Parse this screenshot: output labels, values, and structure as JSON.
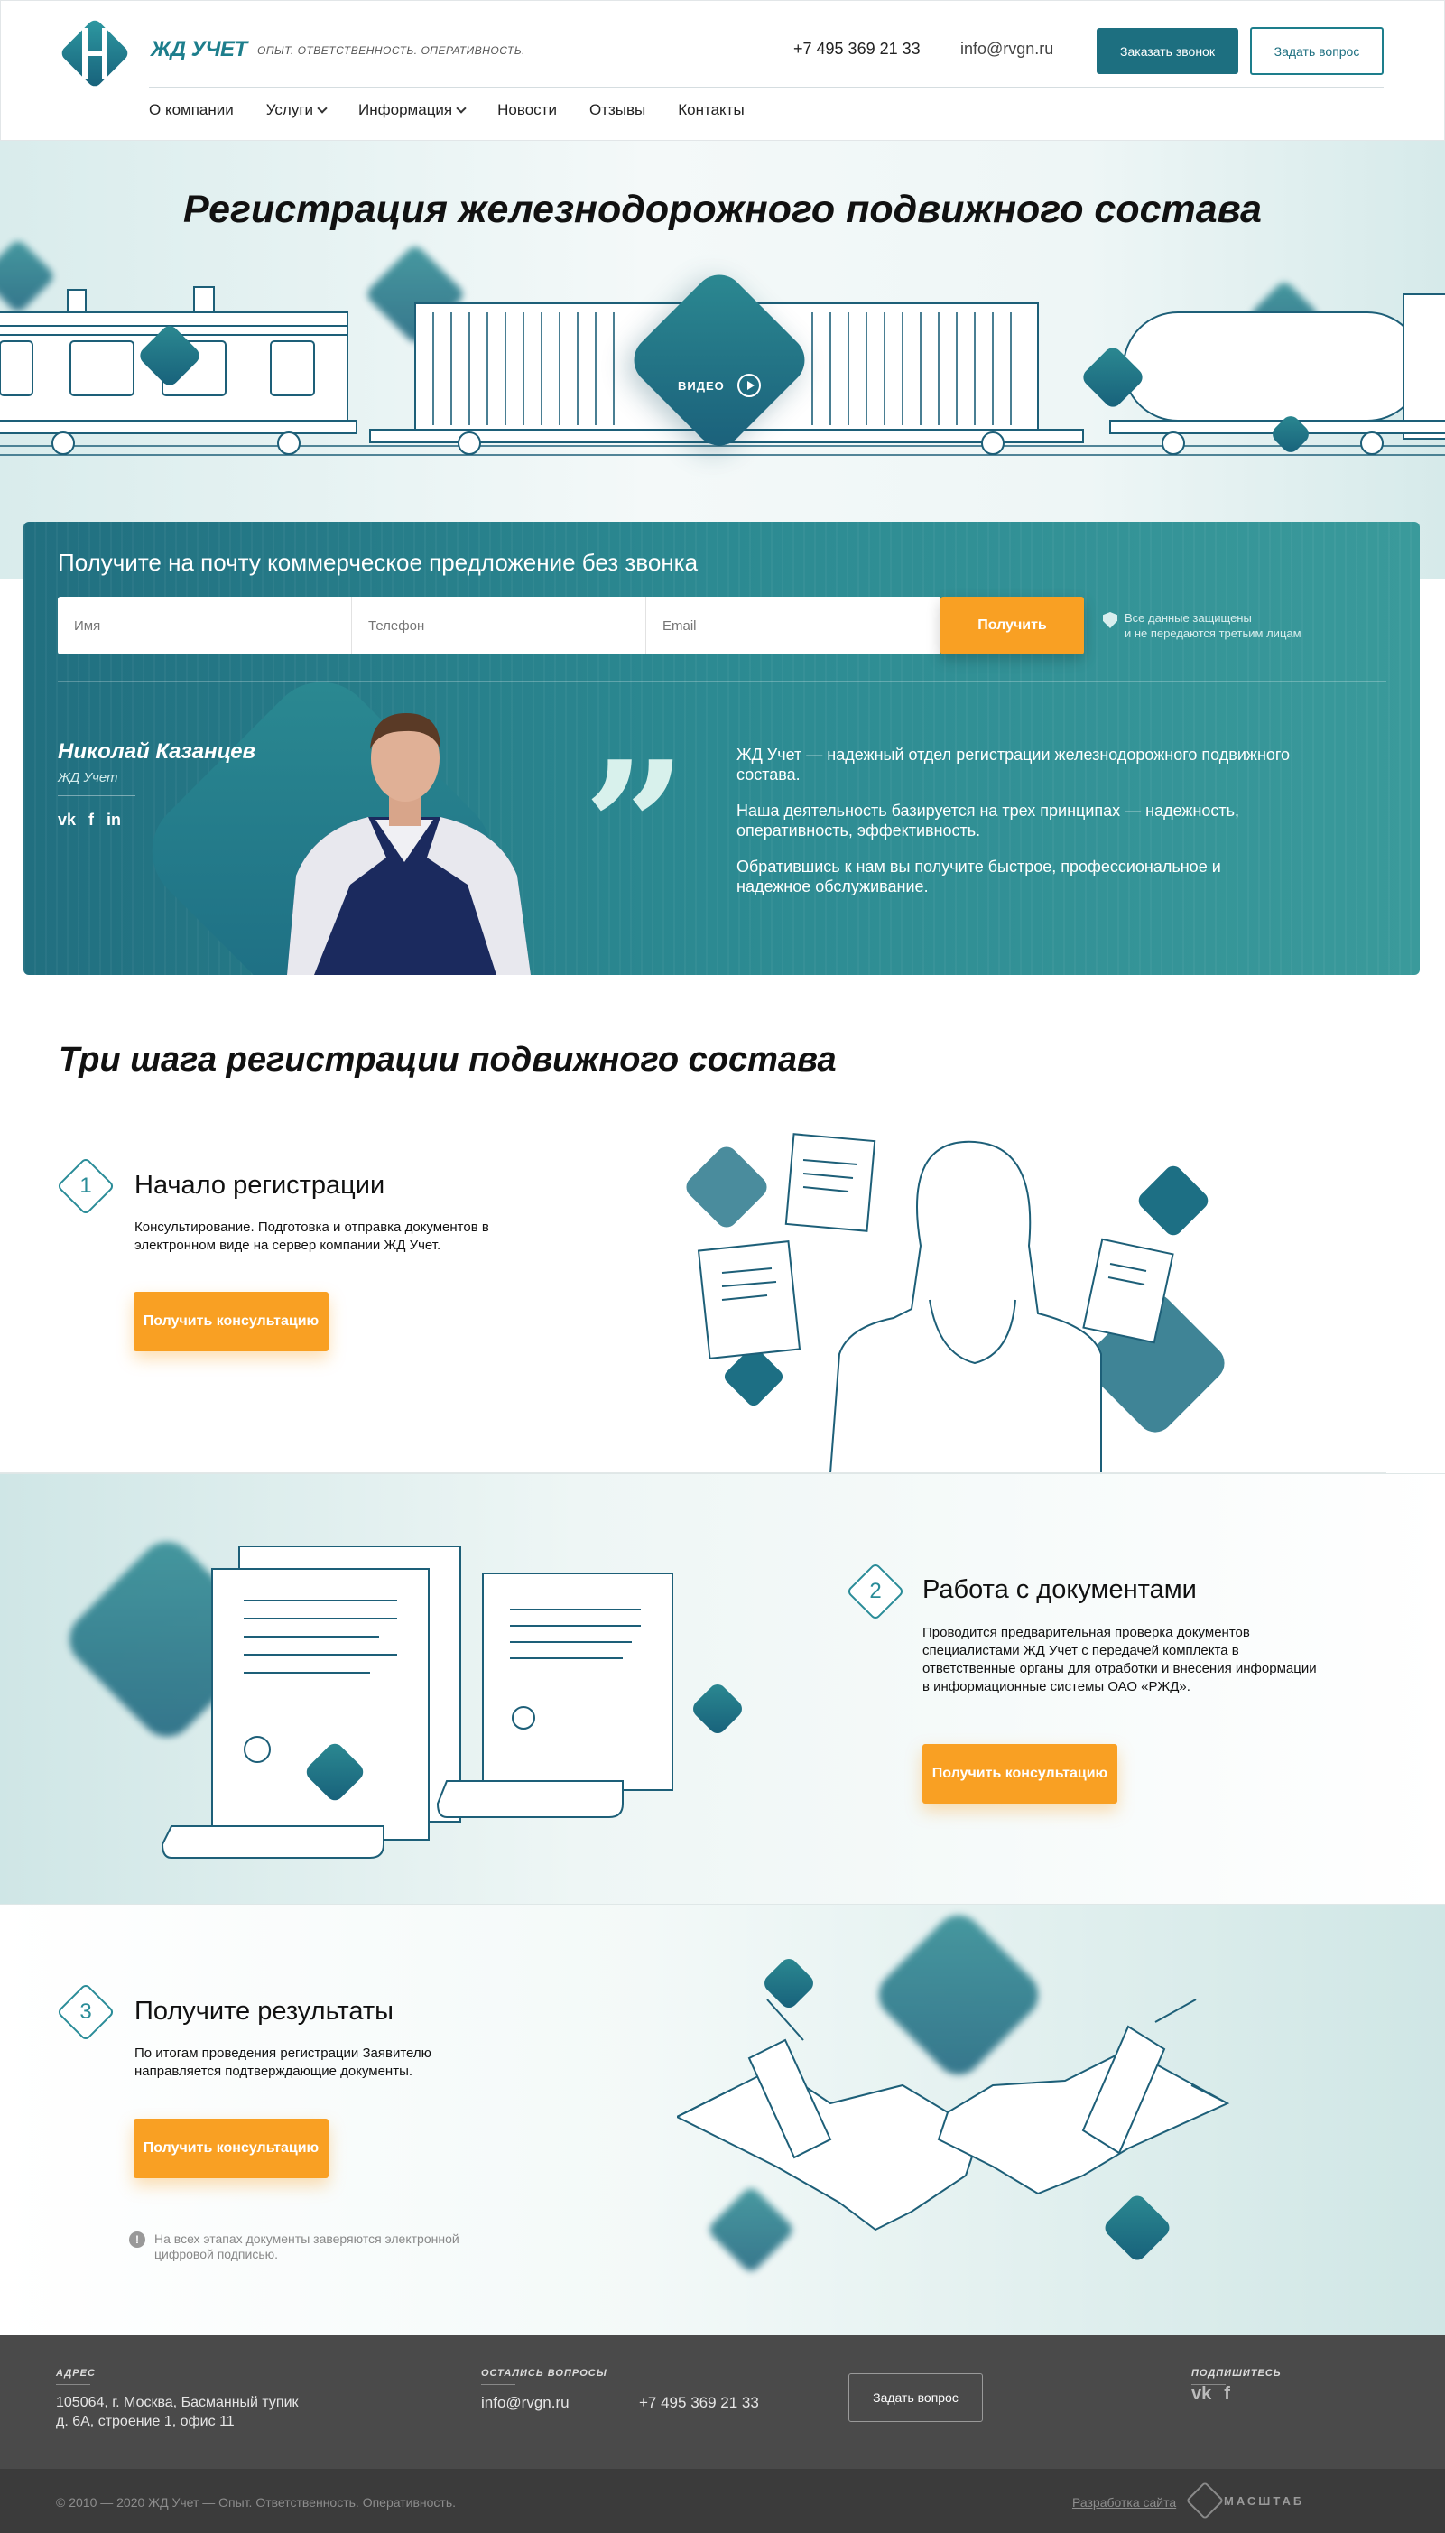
{
  "header": {
    "logo_text": "ЖД УЧЕТ",
    "tagline": "ОПЫТ.  ОТВЕТСТВЕННОСТЬ.  ОПЕРАТИВНОСТЬ.",
    "phone": "+7 495 369 21 33",
    "email": "info@rvgn.ru",
    "call_button": "Заказать звонок",
    "ask_button": "Задать вопрос",
    "nav": [
      {
        "label": "О компании"
      },
      {
        "label": "Услуги"
      },
      {
        "label": "Информация"
      },
      {
        "label": "Новости"
      },
      {
        "label": "Отзывы"
      },
      {
        "label": "Контакты"
      }
    ]
  },
  "hero": {
    "title": "Регистрация железнодорожного подвижного состава",
    "video_label": "ВИДЕО"
  },
  "offer": {
    "title": "Получите на почту коммерческое предложение без звонка",
    "name_placeholder": "Имя",
    "phone_placeholder": "Телефон",
    "email_placeholder": "Email",
    "submit_label": "Получить",
    "secure_line1": "Все данные защищены",
    "secure_line2": "и не передаются третьим лицам",
    "person_name": "Николай Казанцев",
    "person_company": "ЖД Учет",
    "quote_p1": "ЖД Учет — надежный отдел регистрации железнодорожного подвижного состава.",
    "quote_p2": "Наша деятельность базируется на трех принципах — надежность, оперативность, эффективность.",
    "quote_p3": "Обратившись к нам вы получите быстрое, профессиональное и надежное обслуживание."
  },
  "steps": {
    "title": "Три шага регистрации подвижного состава",
    "items": [
      {
        "num": "1",
        "title": "Начало регистрации",
        "desc": "Консультирование. Подготовка и отправка документов в электронном виде на сервер компании ЖД Учет.",
        "button": "Получить консультацию"
      },
      {
        "num": "2",
        "title": "Работа с документами",
        "desc": "Проводится предварительная проверка документов специалистами ЖД Учет с передачей комплекта в ответственные органы для отработки и внесения информации в информационные системы ОАО «РЖД».",
        "button": "Получить консультацию"
      },
      {
        "num": "3",
        "title": "Получите результаты",
        "desc": "По итогам проведения регистрации Заявителю направляется подтверждающие документы.",
        "button": "Получить консультацию"
      }
    ],
    "note": "На всех этапах документы заверяются электронной цифровой подписью."
  },
  "footer": {
    "address_label": "АДРЕС",
    "address_line1": "105064, г. Москва, Басманный тупик",
    "address_line2": "д. 6А, строение 1, офис 11",
    "questions_label": "ОСТАЛИСЬ ВОПРОСЫ",
    "email": "info@rvgn.ru",
    "phone": "+7 495 369 21 33",
    "ask_button": "Задать вопрос",
    "subscribe_label": "ПОДПИШИТЕСЬ",
    "copyright": "© 2010 — 2020     ЖД Учет — Опыт. Ответственность. Оперативность.",
    "developer_link": "Разработка сайта",
    "developer_name": "МАСШТАБ"
  },
  "colors": {
    "accent": "#1d7e8c",
    "orange": "#f9a023",
    "footer": "#4a4a4a"
  }
}
